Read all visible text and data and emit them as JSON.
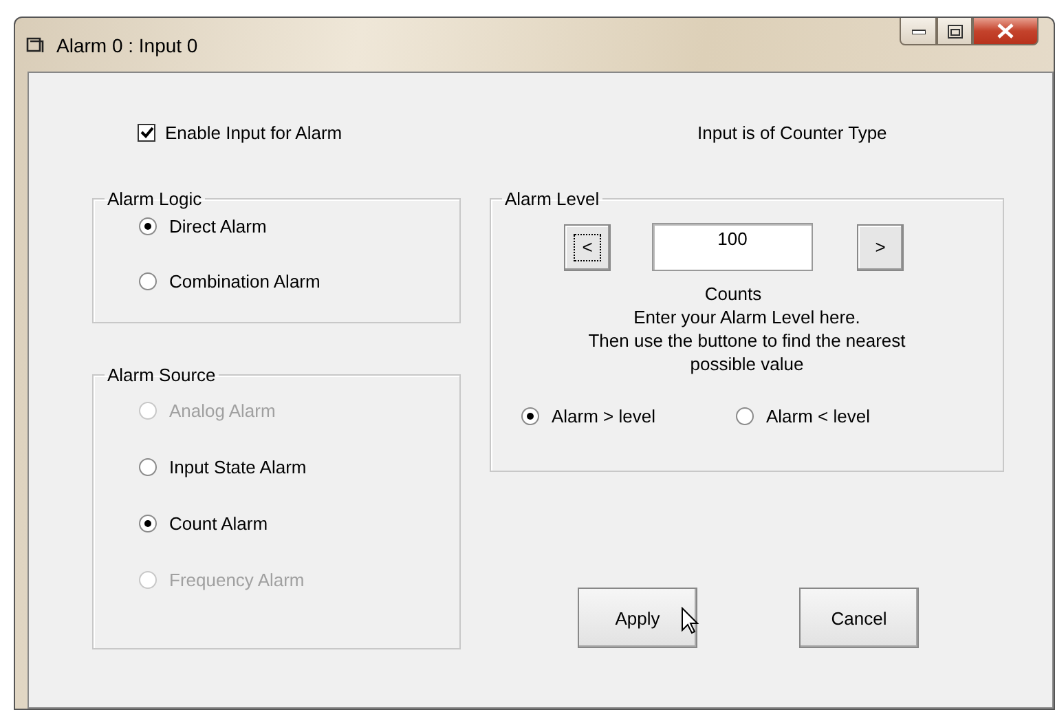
{
  "window": {
    "title": "Alarm 0 : Input 0"
  },
  "enable_input": {
    "label": "Enable Input for Alarm",
    "checked": true
  },
  "input_type": "Input is of Counter Type",
  "alarm_logic": {
    "title": "Alarm Logic",
    "options": [
      {
        "label": "Direct Alarm",
        "selected": true,
        "disabled": false
      },
      {
        "label": "Combination Alarm",
        "selected": false,
        "disabled": false
      }
    ]
  },
  "alarm_source": {
    "title": "Alarm Source",
    "options": [
      {
        "label": "Analog Alarm",
        "selected": false,
        "disabled": true
      },
      {
        "label": "Input State Alarm",
        "selected": false,
        "disabled": false
      },
      {
        "label": "Count Alarm",
        "selected": true,
        "disabled": false
      },
      {
        "label": "Frequency Alarm",
        "selected": false,
        "disabled": true
      }
    ]
  },
  "alarm_level": {
    "title": "Alarm Level",
    "decrease": {
      "label": "<",
      "focused": true
    },
    "value": "100",
    "increase": {
      "label": ">",
      "focused": false
    },
    "unit": "Counts",
    "hint": "Enter your Alarm Level here.\nThen use the buttone to find the nearest\npossible value",
    "options": [
      {
        "label": "Alarm > level",
        "selected": true,
        "disabled": false
      },
      {
        "label": "Alarm < level",
        "selected": false,
        "disabled": false
      }
    ]
  },
  "buttons": [
    {
      "label": "Apply"
    },
    {
      "label": "Cancel"
    }
  ]
}
